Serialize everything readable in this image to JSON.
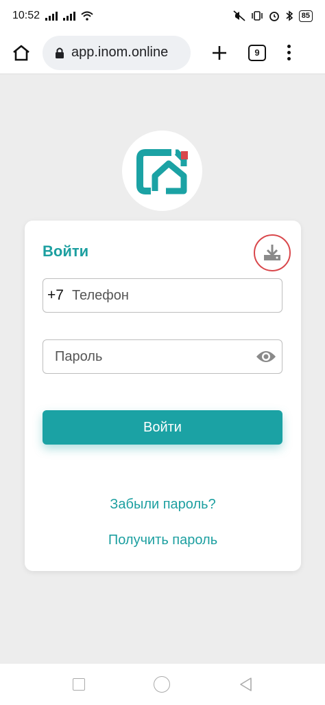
{
  "status_bar": {
    "time": "10:52",
    "battery": "85"
  },
  "browser": {
    "url": "app.inom.online",
    "tab_count": "9"
  },
  "login": {
    "title": "Войти",
    "phone_prefix": "+7",
    "phone_placeholder": "Телефон",
    "password_placeholder": "Пароль",
    "submit_label": "Войти",
    "forgot_link": "Забыли пароль?",
    "get_password_link": "Получить пароль"
  },
  "colors": {
    "accent": "#1ba2a4",
    "download_ring": "#d9474b",
    "background": "#ededed"
  },
  "icons": {
    "home": "home-icon",
    "lock": "lock-icon",
    "plus": "plus-icon",
    "tabs": "tabs-icon",
    "menu": "more-vert-icon",
    "logo": "inom-logo-icon",
    "download": "download-icon",
    "eye": "eye-icon"
  }
}
